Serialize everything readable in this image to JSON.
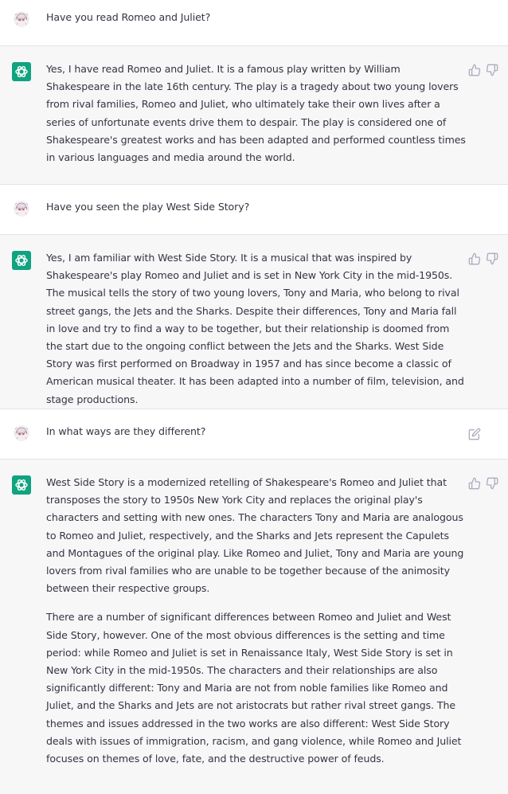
{
  "messages": [
    {
      "role": "user",
      "paragraphs": [
        "Have you read Romeo and Juliet?"
      ]
    },
    {
      "role": "assistant",
      "paragraphs": [
        "Yes, I have read Romeo and Juliet. It is a famous play written by William Shakespeare in the late 16th century. The play is a tragedy about two young lovers from rival families, Romeo and Juliet, who ultimately take their own lives after a series of unfortunate events drive them to despair. The play is considered one of Shakespeare's greatest works and has been adapted and performed countless times in various languages and media around the world."
      ]
    },
    {
      "role": "user",
      "paragraphs": [
        "Have you seen the play West Side Story?"
      ]
    },
    {
      "role": "assistant",
      "paragraphs": [
        "Yes, I am familiar with West Side Story. It is a musical that was inspired by Shakespeare's play Romeo and Juliet and is set in New York City in the mid-1950s. The musical tells the story of two young lovers, Tony and Maria, who belong to rival street gangs, the Jets and the Sharks. Despite their differences, Tony and Maria fall in love and try to find a way to be together, but their relationship is doomed from the start due to the ongoing conflict between the Jets and the Sharks. West Side Story was first performed on Broadway in 1957 and has since become a classic of American musical theater. It has been adapted into a number of film, television, and stage productions."
      ]
    },
    {
      "role": "user",
      "paragraphs": [
        "In what ways are they different?"
      ]
    },
    {
      "role": "assistant",
      "paragraphs": [
        "West Side Story is a modernized retelling of Shakespeare's Romeo and Juliet that transposes the story to 1950s New York City and replaces the original play's characters and setting with new ones. The characters Tony and Maria are analogous to Romeo and Juliet, respectively, and the Sharks and Jets represent the Capulets and Montagues of the original play. Like Romeo and Juliet, Tony and Maria are young lovers from rival families who are unable to be together because of the animosity between their respective groups.",
        "There are a number of significant differences between Romeo and Juliet and West Side Story, however. One of the most obvious differences is the setting and time period: while Romeo and Juliet is set in Renaissance Italy, West Side Story is set in New York City in the mid-1950s. The characters and their relationships are also significantly different: Tony and Maria are not from noble families like Romeo and Juliet, and the Sharks and Jets are not aristocrats but rather rival street gangs. The themes and issues addressed in the two works are also different: West Side Story deals with issues of immigration, racism, and gang violence, while Romeo and Juliet focuses on themes of love, fate, and the destructive power of feuds."
      ]
    }
  ],
  "icons": {
    "user_avatar": "user-avatar-icon",
    "assistant_avatar": "openai-logo-icon",
    "thumbs_up": "thumbs-up-icon",
    "thumbs_down": "thumbs-down-icon",
    "edit": "edit-icon"
  },
  "colors": {
    "assistant_bg": "#f7f7f8",
    "user_bg": "#ffffff",
    "brand": "#10a37f",
    "text": "#343541",
    "icon": "#acacbe"
  }
}
